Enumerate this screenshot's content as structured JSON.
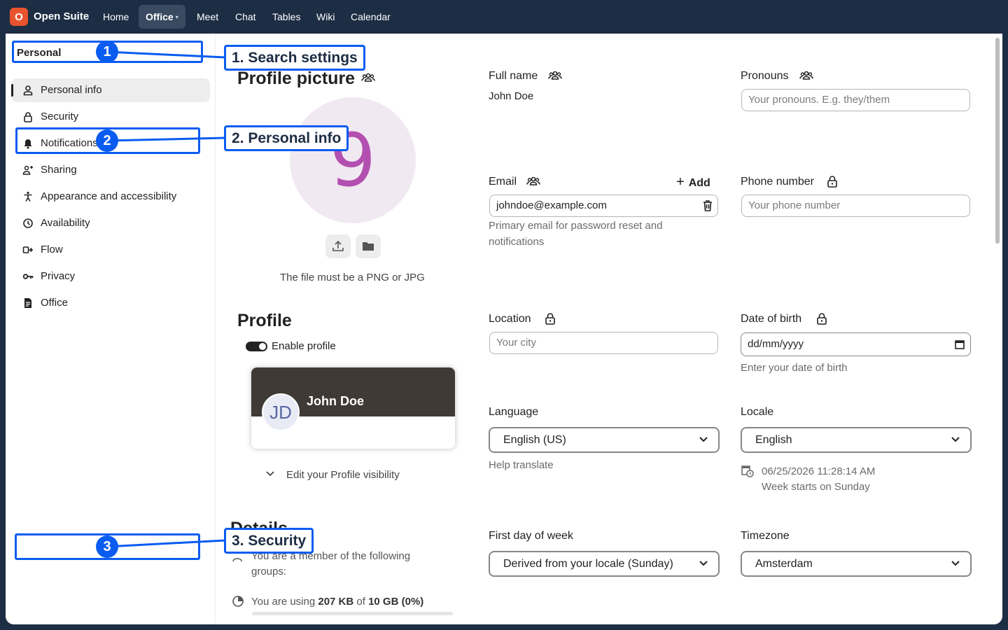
{
  "topbar": {
    "logo_letter": "O",
    "brand": "Open Suite",
    "nav": [
      {
        "label": "Home",
        "active": false
      },
      {
        "label": "Office",
        "active": true
      },
      {
        "label": "Meet",
        "active": false
      },
      {
        "label": "Chat",
        "active": false
      },
      {
        "label": "Tables",
        "active": false
      },
      {
        "label": "Wiki",
        "active": false
      },
      {
        "label": "Calendar",
        "active": false
      }
    ],
    "caret": "▾"
  },
  "sidebar": {
    "heading": "Personal",
    "items": [
      {
        "label": "Personal info",
        "icon": "user-icon",
        "active": true
      },
      {
        "label": "Security",
        "icon": "lock-icon",
        "active": false
      },
      {
        "label": "Notifications",
        "icon": "bell-icon",
        "active": false
      },
      {
        "label": "Sharing",
        "icon": "share-user-icon",
        "active": false
      },
      {
        "label": "Appearance and accessibility",
        "icon": "accessibility-icon",
        "active": false
      },
      {
        "label": "Availability",
        "icon": "clock-icon",
        "active": false
      },
      {
        "label": "Flow",
        "icon": "flow-icon",
        "active": false
      },
      {
        "label": "Privacy",
        "icon": "key-icon",
        "active": false
      },
      {
        "label": "Office",
        "icon": "document-icon",
        "active": false
      }
    ]
  },
  "profile_picture": {
    "title": "Profile picture",
    "avatar_initial": "9",
    "hint": "The file must be a PNG or JPG"
  },
  "profile": {
    "title": "Profile",
    "toggle_label": "Enable profile",
    "card_name": "John Doe",
    "card_initials": "JD",
    "visibility_label": "Edit your Profile visibility"
  },
  "details": {
    "title": "Details",
    "groups_text": "You are a member of the following groups:",
    "usage_prefix": "You are using ",
    "usage_used": "207 KB",
    "usage_of": " of ",
    "usage_total": "10 GB",
    "usage_percent": " (0%)",
    "usage_fraction": 0.0
  },
  "fields": {
    "full_name_label": "Full name",
    "full_name_value": "John Doe",
    "pronouns_label": "Pronouns",
    "pronouns_placeholder": "Your pronouns. E.g. they/them",
    "email_label": "Email",
    "email_add": "Add",
    "email_value": "johndoe@example.com",
    "email_hint": "Primary email for password reset and notifications",
    "phone_label": "Phone number",
    "phone_placeholder": "Your phone number",
    "location_label": "Location",
    "location_placeholder": "Your city",
    "dob_label": "Date of birth",
    "dob_value": "dd/mm/yyyy",
    "dob_hint": "Enter your date of birth",
    "language_label": "Language",
    "language_value": "English (US)",
    "language_help": "Help translate",
    "locale_label": "Locale",
    "locale_value": "English",
    "locale_time": "06/25/2026 11:28:14 AM",
    "locale_week": "Week starts on Sunday",
    "first_day_label": "First day of week",
    "first_day_value": "Derived from your locale (Sunday)",
    "timezone_label": "Timezone",
    "timezone_value": "Amsterdam"
  },
  "annotations": [
    {
      "num": "1",
      "label": "1. Search settings"
    },
    {
      "num": "2",
      "label": "2. Personal info"
    },
    {
      "num": "3",
      "label": "3. Security"
    }
  ],
  "colors": {
    "topbar": "#1d2d44",
    "accent": "#0a5cf0",
    "logo": "#e9542e",
    "avatar_fg": "#b34fb0"
  }
}
